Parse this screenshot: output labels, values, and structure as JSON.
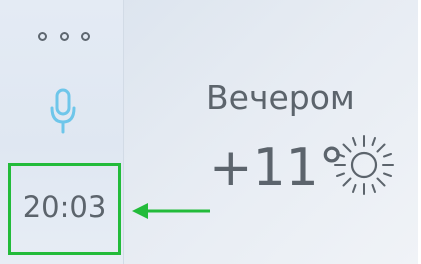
{
  "sidebar": {
    "more_icon": "more-dots-icon",
    "mic_icon": "microphone-icon",
    "time": "20:03"
  },
  "weather": {
    "period": "Вечером",
    "temperature": "+11°",
    "condition_icon": "sun-icon"
  },
  "colors": {
    "accent_mic": "#6ec6ea",
    "highlight": "#22bb3a",
    "text": "#5c646c"
  }
}
